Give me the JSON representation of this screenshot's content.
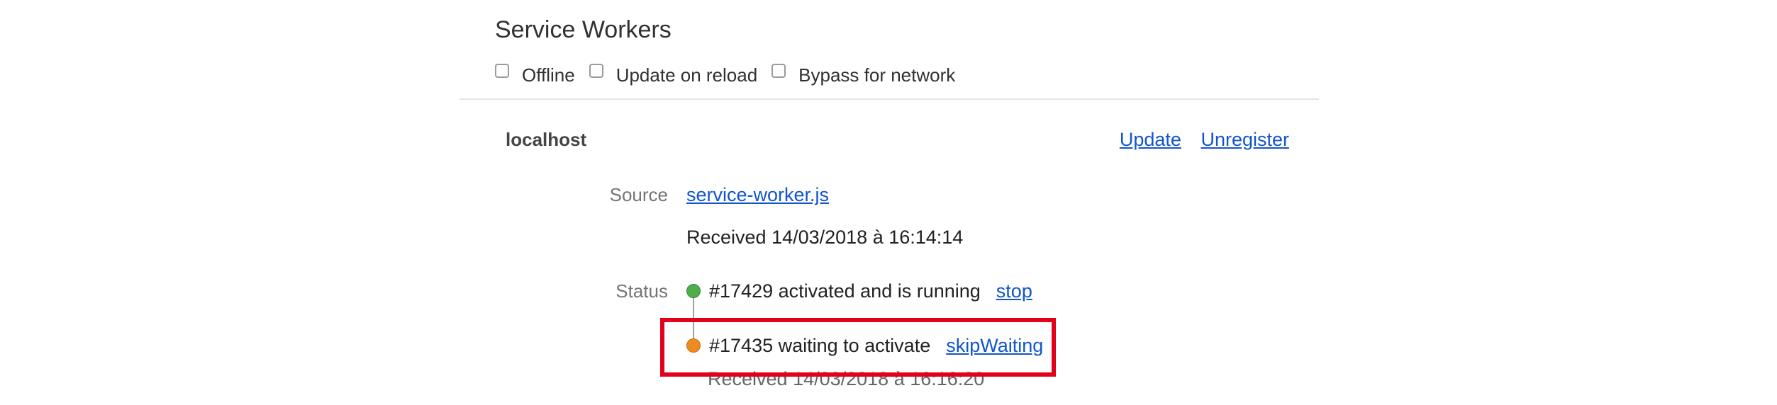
{
  "panel": {
    "title": "Service Workers",
    "options": [
      {
        "label": "Offline",
        "checked": false
      },
      {
        "label": "Update on reload",
        "checked": false
      },
      {
        "label": "Bypass for network",
        "checked": false
      }
    ]
  },
  "registration": {
    "host": "localhost",
    "update_label": "Update",
    "unregister_label": "Unregister",
    "source_label": "Source",
    "source_file": "service-worker.js",
    "received_text": "Received 14/03/2018 à 16:14:14",
    "status_label": "Status",
    "workers": [
      {
        "status_text": "#17429 activated and is running",
        "action_label": "stop",
        "dot_color": "#4fae4a"
      },
      {
        "status_text": "#17435 waiting to activate",
        "action_label": "skipWaiting",
        "dot_color": "#ee8a22",
        "received_text": "Received 14/03/2018 à 16:16:20"
      }
    ]
  },
  "annotation": {
    "highlight_color": "#e3001b"
  },
  "colors": {
    "link": "#1155cc",
    "label_gray": "#757575"
  }
}
